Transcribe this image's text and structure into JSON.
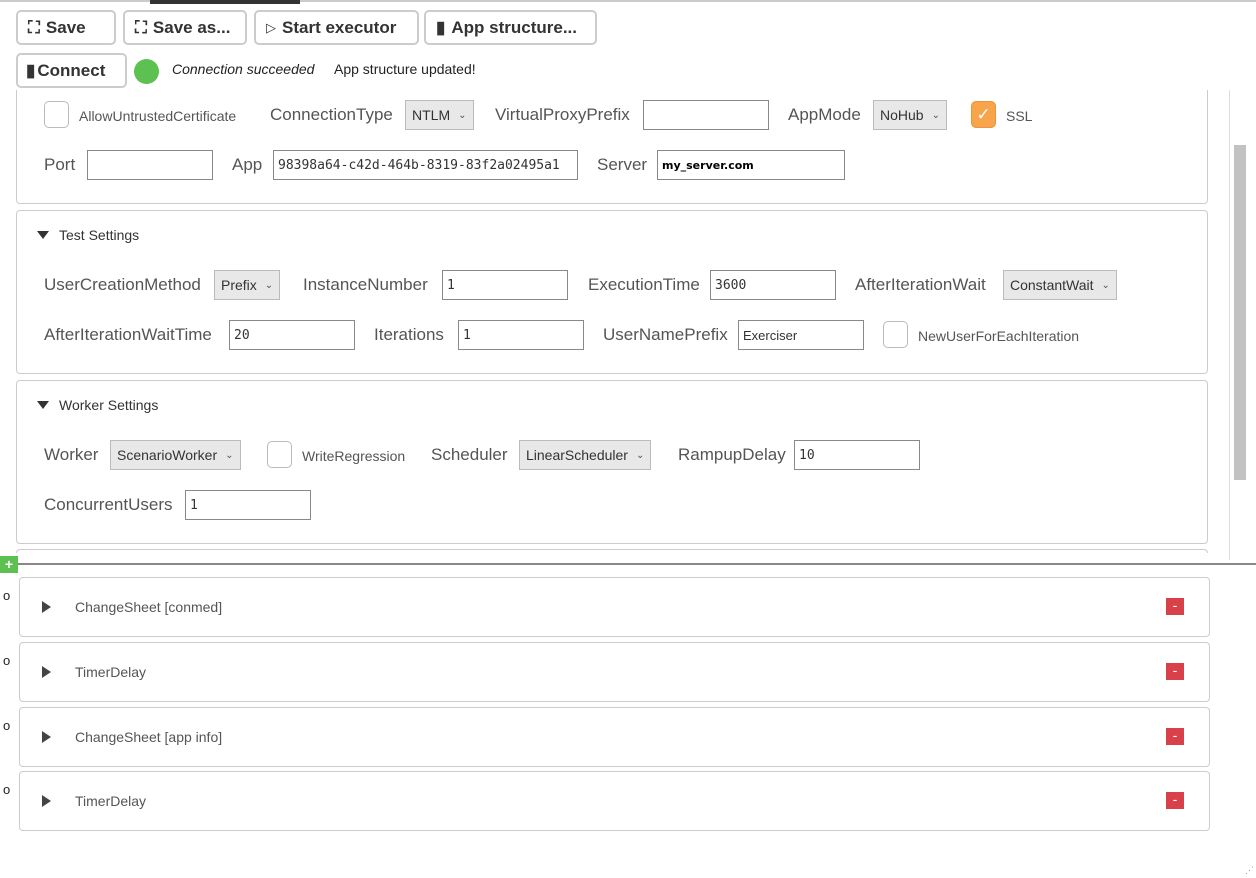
{
  "toolbar": {
    "save": "Save",
    "save_as": "Save as...",
    "start_executor": "Start executor",
    "app_structure": "App structure...",
    "connect": "Connect"
  },
  "status": {
    "connection": "Connection succeeded",
    "app": "App structure updated!",
    "color": "#5cc151"
  },
  "connection": {
    "allow_untrusted_label": "AllowUntrustedCertificate",
    "allow_untrusted": false,
    "connection_type_label": "ConnectionType",
    "connection_type": "NTLM",
    "virtual_proxy_label": "VirtualProxyPrefix",
    "virtual_proxy": "",
    "app_mode_label": "AppMode",
    "app_mode": "NoHub",
    "ssl_label": "SSL",
    "ssl": true,
    "port_label": "Port",
    "port": "",
    "app_label": "App",
    "app": "98398a64-c42d-464b-8319-83f2a02495a1",
    "server_label": "Server",
    "server": "my_server.com"
  },
  "test_settings": {
    "title": "Test Settings",
    "user_creation_label": "UserCreationMethod",
    "user_creation": "Prefix",
    "instance_label": "InstanceNumber",
    "instance": "1",
    "exec_time_label": "ExecutionTime",
    "exec_time": "3600",
    "after_wait_label": "AfterIterationWait",
    "after_wait": "ConstantWait",
    "after_wait_time_label": "AfterIterationWaitTime",
    "after_wait_time": "20",
    "iterations_label": "Iterations",
    "iterations": "1",
    "prefix_label": "UserNamePrefix",
    "prefix": "Exerciser",
    "new_user_label": "NewUserForEachIteration",
    "new_user": false
  },
  "worker_settings": {
    "title": "Worker Settings",
    "worker_label": "Worker",
    "worker": "ScenarioWorker",
    "write_regression_label": "WriteRegression",
    "write_regression": false,
    "scheduler_label": "Scheduler",
    "scheduler": "LinearScheduler",
    "rampup_label": "RampupDelay",
    "rampup": "10",
    "concurrent_label": "ConcurrentUsers",
    "concurrent": "1"
  },
  "steps": [
    {
      "name": "ChangeSheet [conmed]",
      "marker": "o"
    },
    {
      "name": "TimerDelay",
      "marker": "o"
    },
    {
      "name": "ChangeSheet [app info]",
      "marker": "o"
    },
    {
      "name": "TimerDelay",
      "marker": "o"
    }
  ],
  "icons": {
    "plus": "+",
    "minus": "-",
    "check": "✓",
    "chev": "⌄"
  }
}
